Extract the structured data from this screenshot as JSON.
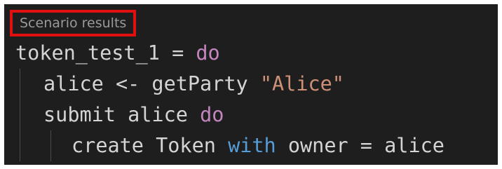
{
  "codelens": {
    "label": "Scenario results"
  },
  "code": {
    "line1": {
      "name": "token_test_1",
      "op": " = ",
      "kw": "do"
    },
    "line2": {
      "text": "alice <- getParty ",
      "str": "\"Alice\""
    },
    "line3": {
      "text": "submit alice ",
      "kw": "do"
    },
    "line4": {
      "pre": "create Token ",
      "kw": "with",
      "post": " owner = alice"
    }
  },
  "colors": {
    "background": "#1e1e1e",
    "highlight_box": "#e01010",
    "keyword": "#c586c0",
    "string": "#ce9178",
    "with_keyword": "#569cd6"
  }
}
